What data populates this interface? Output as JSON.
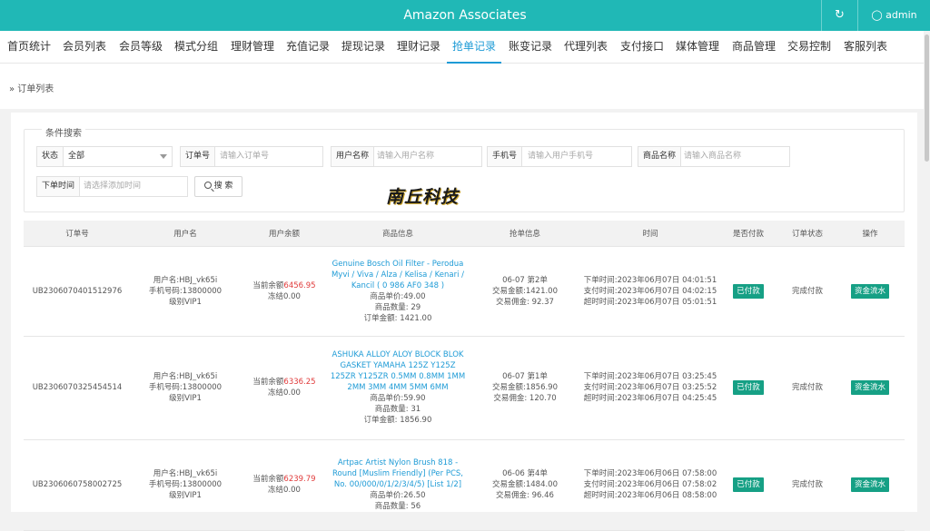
{
  "header": {
    "title": "Amazon Associates",
    "refresh_icon": "↻",
    "user_icon": "user-icon",
    "user_label": "admin",
    "bg_color": "#20b8b6"
  },
  "nav": [
    {
      "label": "首页统计"
    },
    {
      "label": "会员列表"
    },
    {
      "label": "会员等级"
    },
    {
      "label": "模式分组"
    },
    {
      "label": "理财管理"
    },
    {
      "label": "充值记录"
    },
    {
      "label": "提现记录"
    },
    {
      "label": "理财记录"
    },
    {
      "label": "抢单记录",
      "active": true
    },
    {
      "label": "账变记录"
    },
    {
      "label": "代理列表"
    },
    {
      "label": "支付接口"
    },
    {
      "label": "媒体管理"
    },
    {
      "label": "商品管理"
    },
    {
      "label": "交易控制"
    },
    {
      "label": "客服列表"
    }
  ],
  "breadcrumb": "» 订单列表",
  "search": {
    "legend": "条件搜索",
    "status_label": "状态",
    "status_value": "全部",
    "order_no_label": "订单号",
    "order_no_placeholder": "请输入订单号",
    "username_label": "用户名称",
    "username_placeholder": "请输入用户名称",
    "phone_label": "手机号",
    "phone_placeholder": "请输入用户手机号",
    "product_label": "商品名称",
    "product_placeholder": "请输入商品名称",
    "time_label": "下单时间",
    "time_placeholder": "请选择添加时间",
    "button_label": "搜 索"
  },
  "watermark": "南丘科技",
  "table": {
    "headers": [
      "订单号",
      "用户名",
      "用户余额",
      "商品信息",
      "抢单信息",
      "时间",
      "是否付款",
      "订单状态",
      "操作"
    ],
    "rows": [
      {
        "order_no": "UB2306070401512976",
        "user": {
          "name": "用户名:HBJ_vk65i",
          "phone": "手机号码:13800000",
          "level": "级别VIP1"
        },
        "balance_label": "当前余额",
        "balance_value": "6456.95",
        "frozen": "冻结0.00",
        "product_title": "Genuine Bosch Oil Filter - Perodua Myvi / Viva / Alza / Kelisa / Kenari / Kancil ( 0 986 AF0 348 )",
        "unit_price": "商品单价:49.00",
        "qty": "商品数量: 29",
        "amount": "订单金额: 1421.00",
        "grab_date": "06-07 第2单",
        "trade_amount": "交易金额:1421.00",
        "commission": "交易佣金: 92.37",
        "order_time": "下单时间:2023年06月07日 04:01:51",
        "pay_time": "支付时间:2023年06月07日 04:02:15",
        "timeout": "超时时间:2023年06月07日 05:01:51",
        "paid": "已付款",
        "status": "完成付款",
        "action": "资金流水"
      },
      {
        "order_no": "UB2306070325454514",
        "user": {
          "name": "用户名:HBJ_vk65i",
          "phone": "手机号码:13800000",
          "level": "级别VIP1"
        },
        "balance_label": "当前余额",
        "balance_value": "6336.25",
        "frozen": "冻结0.00",
        "product_title": "ASHUKA ALLOY ALOY BLOCK BLOK GASKET YAMAHA 125Z Y125Z 125ZR Y125ZR 0.5MM 0.8MM 1MM 2MM 3MM 4MM 5MM 6MM",
        "unit_price": "商品单价:59.90",
        "qty": "商品数量: 31",
        "amount": "订单金额: 1856.90",
        "grab_date": "06-07 第1单",
        "trade_amount": "交易金额:1856.90",
        "commission": "交易佣金: 120.70",
        "order_time": "下单时间:2023年06月07日 03:25:45",
        "pay_time": "支付时间:2023年06月07日 03:25:52",
        "timeout": "超时时间:2023年06月07日 04:25:45",
        "paid": "已付款",
        "status": "完成付款",
        "action": "资金流水"
      },
      {
        "order_no": "UB2306060758002725",
        "user": {
          "name": "用户名:HBJ_vk65i",
          "phone": "手机号码:13800000",
          "level": "级别VIP1"
        },
        "balance_label": "当前余额",
        "balance_value": "6239.79",
        "frozen": "冻结0.00",
        "product_title": "Artpac Artist Nylon Brush 818 - Round [Muslim Friendly] (Per PCS, No. 00/000/0/1/2/3/4/5) [List 1/2]",
        "unit_price": "商品单价:26.50",
        "qty": "商品数量: 56",
        "amount": "",
        "grab_date": "06-06 第4单",
        "trade_amount": "交易金额:1484.00",
        "commission": "交易佣金: 96.46",
        "order_time": "下单时间:2023年06月06日 07:58:00",
        "pay_time": "支付时间:2023年06月06日 07:58:02",
        "timeout": "超时时间:2023年06月06日 08:58:00",
        "paid": "已付款",
        "status": "完成付款",
        "action": "资金流水"
      }
    ]
  }
}
